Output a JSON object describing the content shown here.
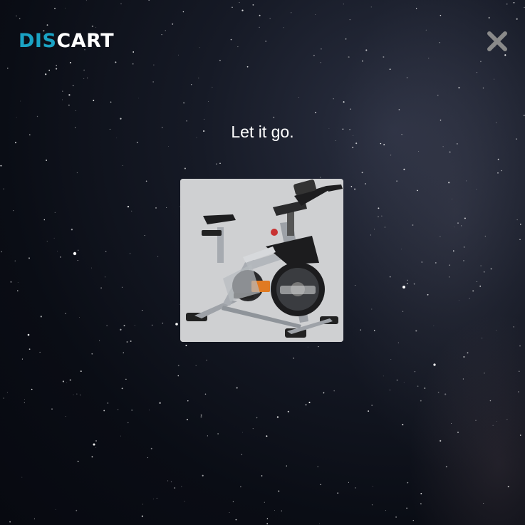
{
  "logo": {
    "part_a": "DIS",
    "part_b": "CART",
    "color_a": "#1aa3c4",
    "color_b": "#ffffff"
  },
  "close": {
    "icon": "close-icon",
    "color": "#8a8a8a"
  },
  "headline": "Let it go.",
  "product": {
    "image_icon": "exercise-bike-image",
    "background": "#cfd0d2",
    "accent": "#e07a22"
  }
}
